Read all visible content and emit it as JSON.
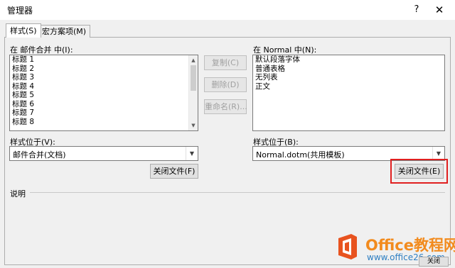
{
  "window": {
    "title": "管理器",
    "help_label": "?",
    "close_label": "✕"
  },
  "tabs": [
    {
      "label": "样式(S)"
    },
    {
      "label": "宏方案项(M)"
    }
  ],
  "left": {
    "list_label": "在 邮件合并 中(I):",
    "items": [
      "标题 1",
      "标题 2",
      "标题 3",
      "标题 4",
      "标题 5",
      "标题 6",
      "标题 7",
      "标题 8"
    ],
    "location_label": "样式位于(V):",
    "location_value": "邮件合并(文档)",
    "close_file_button": "关闭文件(F)"
  },
  "middle": {
    "copy_button": "复制(C)",
    "delete_button": "删除(D)",
    "rename_button": "重命名(R)..."
  },
  "right": {
    "list_label": "在 Normal 中(N):",
    "items": [
      "默认段落字体",
      "普通表格",
      "无列表",
      "正文"
    ],
    "location_label": "样式位于(B):",
    "location_value": "Normal.dotm(共用模板)",
    "close_file_button": "关闭文件(E)"
  },
  "description_label": "说明",
  "watermark": {
    "brand": "Office教程网",
    "url": "www.office26.com"
  },
  "bottom_button": "关闭"
}
